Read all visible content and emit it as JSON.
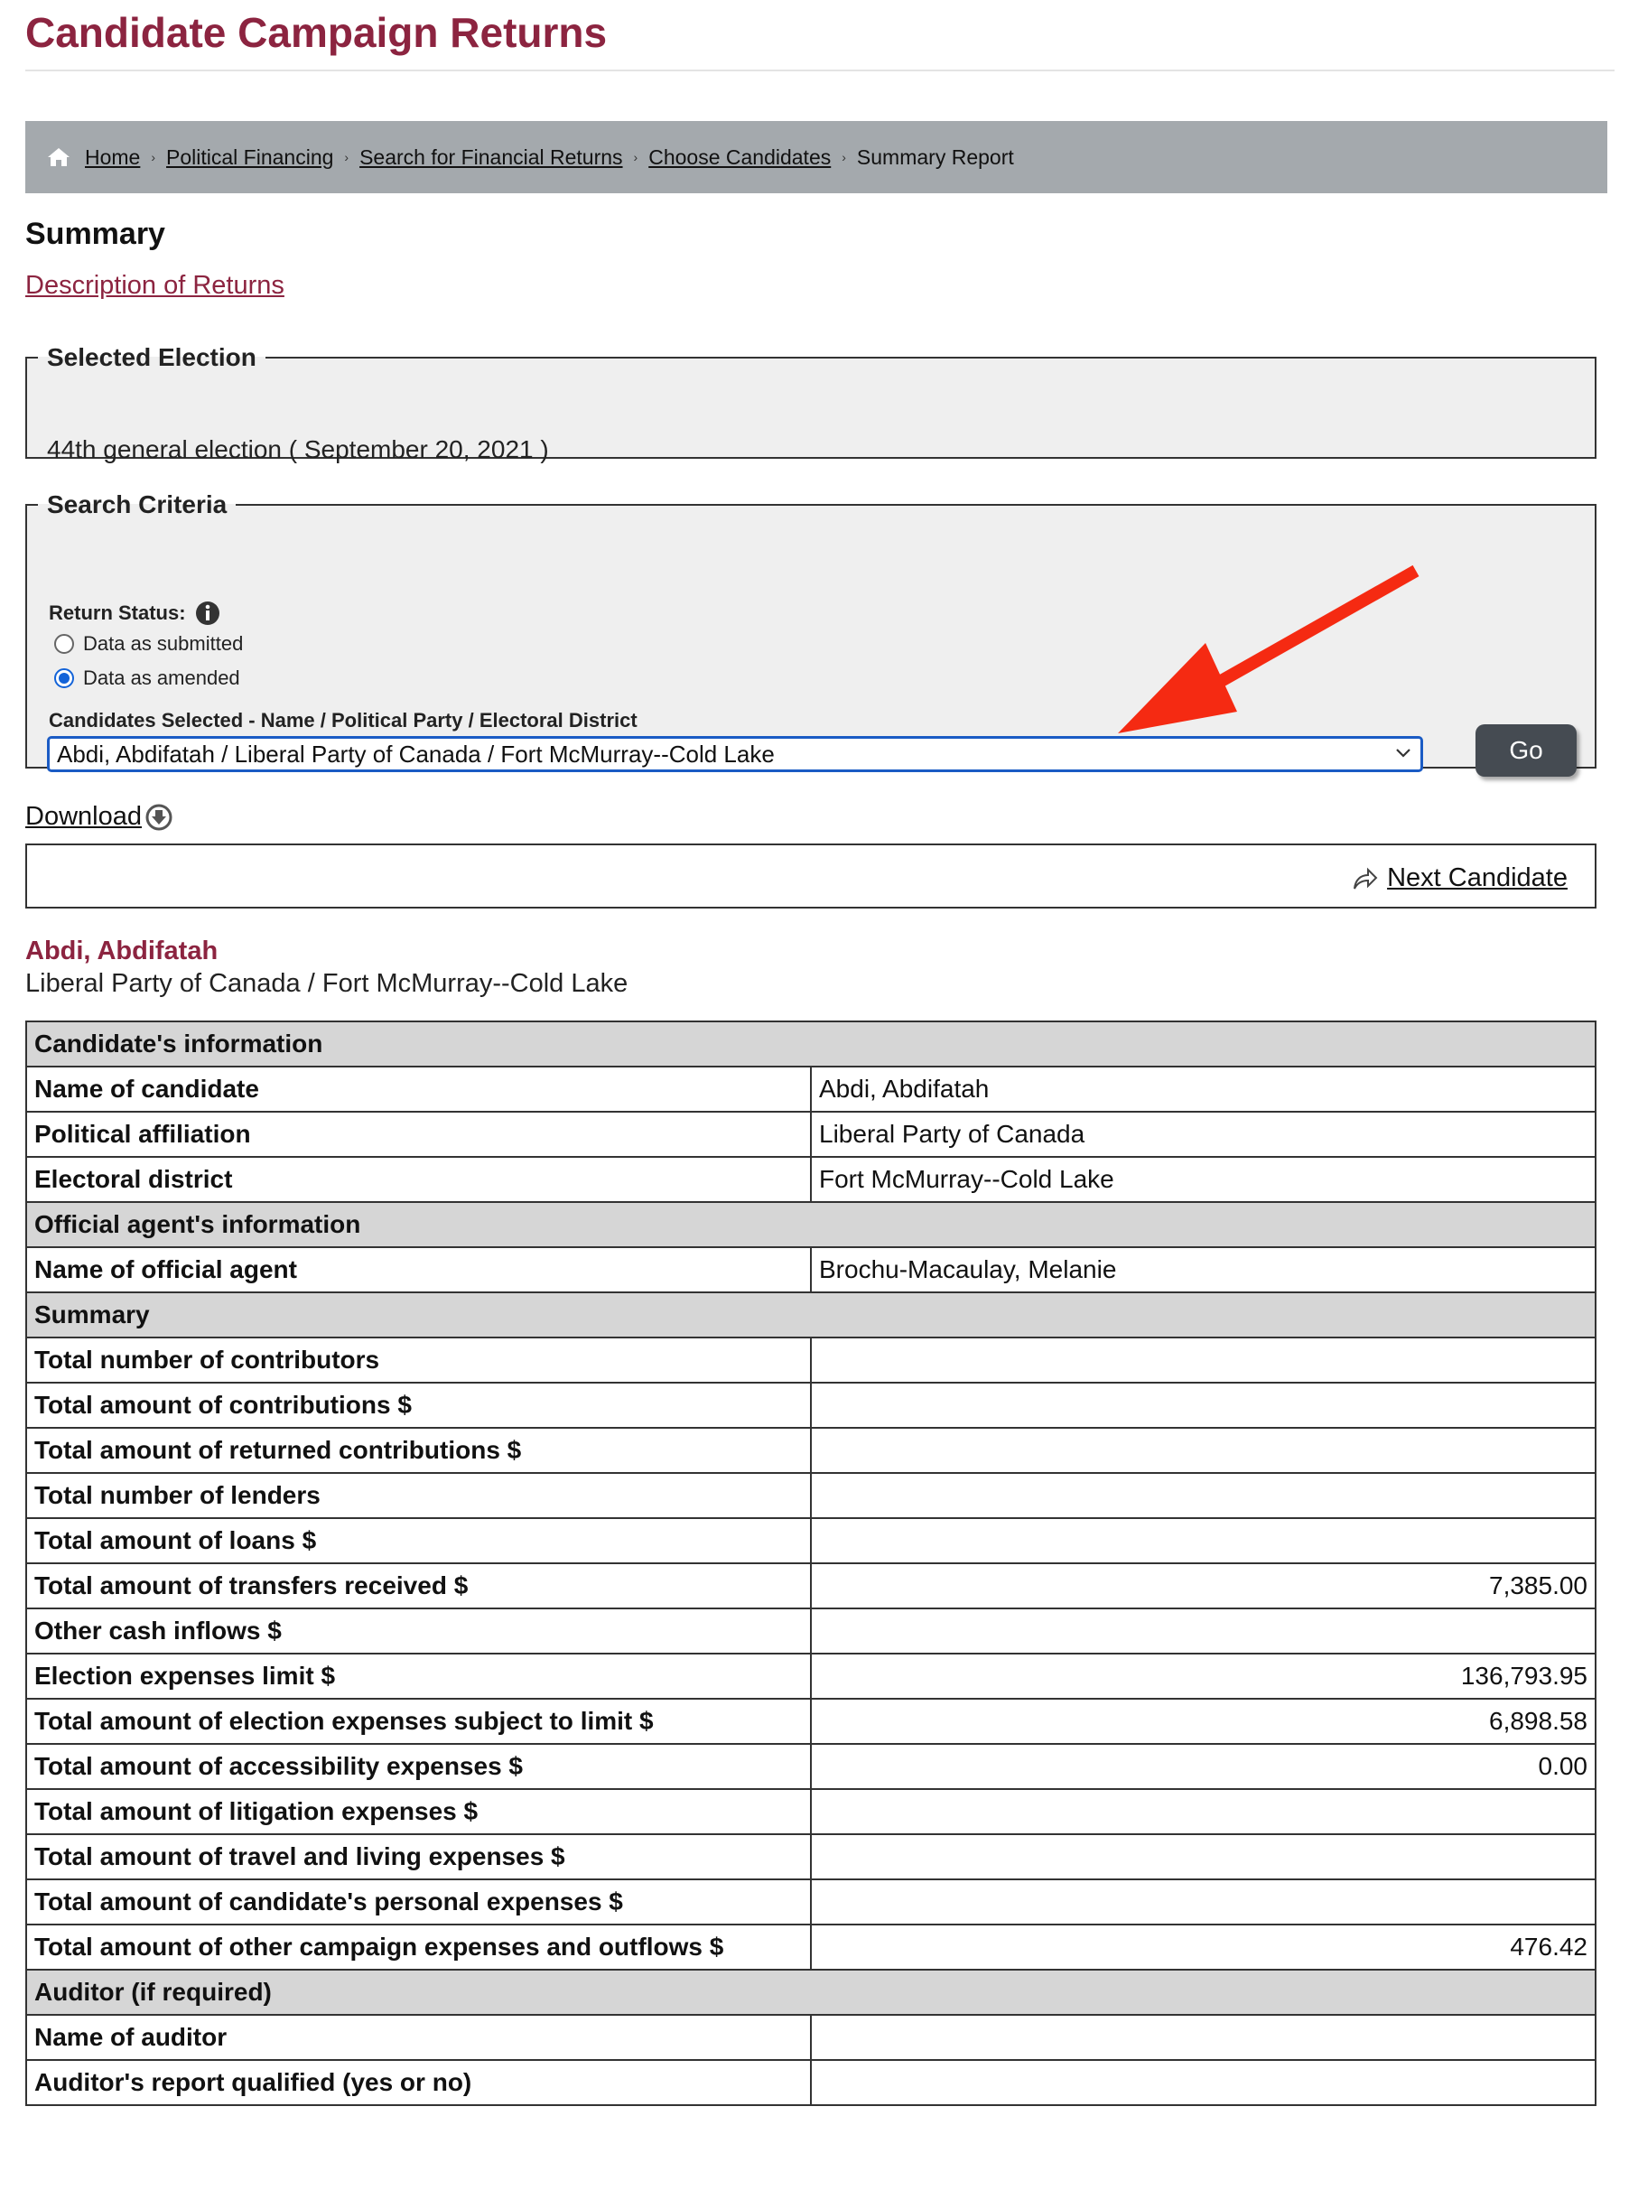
{
  "page": {
    "title": "Candidate Campaign Returns"
  },
  "breadcrumb": {
    "home": "Home",
    "political_financing": "Political Financing",
    "search_returns": "Search for Financial Returns",
    "choose_candidates": "Choose Candidates",
    "current": "Summary Report",
    "separator": "›"
  },
  "summary_heading": "Summary",
  "description_link": "Description of Returns",
  "selected_election": {
    "legend": "Selected Election",
    "text": "44th general election ( September 20, 2021 )"
  },
  "search_criteria": {
    "legend": "Search Criteria",
    "return_status_label": "Return Status:",
    "radio_submitted": "Data as submitted",
    "radio_amended": "Data as amended",
    "selected_radio": "amended",
    "candidates_label": "Candidates Selected - Name / Political Party / Electoral District",
    "candidate_value": "Abdi, Abdifatah / Liberal Party of Canada / Fort McMurray--Cold Lake",
    "go_label": "Go"
  },
  "download_label": "Download",
  "next_candidate_label": "Next Candidate",
  "candidate": {
    "name": "Abdi, Abdifatah",
    "subtitle": "Liberal Party of Canada / Fort McMurray--Cold Lake"
  },
  "table": {
    "sec_candidate": "Candidate's information",
    "name_label": "Name of candidate",
    "name_value": "Abdi, Abdifatah",
    "party_label": "Political affiliation",
    "party_value": "Liberal Party of Canada",
    "district_label": "Electoral district",
    "district_value": "Fort McMurray--Cold Lake",
    "sec_agent": "Official agent's information",
    "agent_label": "Name of official agent",
    "agent_value": "Brochu-Macaulay, Melanie",
    "sec_summary": "Summary",
    "rows": [
      {
        "label": "Total number of contributors",
        "value": ""
      },
      {
        "label": "Total amount of contributions $",
        "value": ""
      },
      {
        "label": "Total amount of returned contributions $",
        "value": ""
      },
      {
        "label": "Total number of lenders",
        "value": ""
      },
      {
        "label": "Total amount of loans $",
        "value": ""
      },
      {
        "label": "Total amount of transfers received $",
        "value": "7,385.00"
      },
      {
        "label": "Other cash inflows $",
        "value": ""
      },
      {
        "label": "Election expenses limit $",
        "value": "136,793.95"
      },
      {
        "label": "Total amount of election expenses subject to limit $",
        "value": "6,898.58"
      },
      {
        "label": "Total amount of accessibility expenses $",
        "value": "0.00"
      },
      {
        "label": "Total amount of litigation expenses $",
        "value": ""
      },
      {
        "label": "Total amount of travel and living expenses $",
        "value": ""
      },
      {
        "label": "Total amount of candidate's personal expenses $",
        "value": ""
      },
      {
        "label": "Total amount of other campaign expenses and outflows $",
        "value": "476.42"
      }
    ],
    "sec_auditor": "Auditor (if required)",
    "auditor_label": "Name of auditor",
    "auditor_value": "",
    "qualified_label": "Auditor's report qualified (yes or no)",
    "qualified_value": ""
  },
  "colors": {
    "brand": "#8c2440",
    "breadcrumb_bg": "#a4a9ad",
    "arrow": "#f52a12",
    "focus": "#1a5bc4"
  },
  "icons": {
    "home": "home-icon",
    "info": "info-icon",
    "download": "download-icon",
    "next": "share-arrow-icon",
    "dropdown": "chevron-down-icon"
  }
}
